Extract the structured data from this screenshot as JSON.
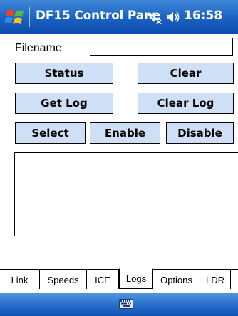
{
  "titlebar": {
    "title": "DF15 Control Pane",
    "time": "16:58",
    "icons": [
      "windows-logo-icon",
      "connectivity-icon",
      "volume-icon"
    ]
  },
  "form": {
    "filename_label": "Filename",
    "filename_value": "",
    "buttons": {
      "status": "Status",
      "clear": "Clear",
      "get_log": "Get Log",
      "clear_log": "Clear Log",
      "select": "Select",
      "enable": "Enable",
      "disable": "Disable"
    },
    "log_text": ""
  },
  "tabs": [
    {
      "label": "Link"
    },
    {
      "label": "Speeds"
    },
    {
      "label": "ICE"
    },
    {
      "label": "Logs",
      "active": true
    },
    {
      "label": "Options"
    },
    {
      "label": "LDR"
    }
  ],
  "bottombar": {
    "icons": [
      "keyboard-icon"
    ]
  },
  "colors": {
    "titlebar": "#1d64c2",
    "button_bg": "#cfdff6",
    "bottombar": "#2a6fcb"
  }
}
